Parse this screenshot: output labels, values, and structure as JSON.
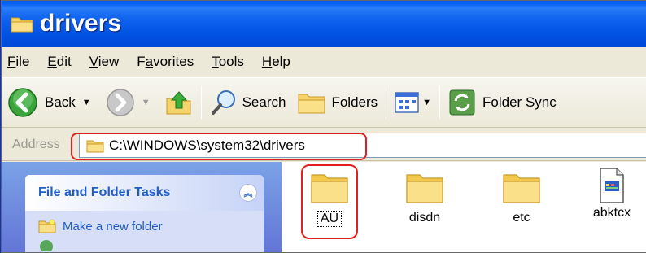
{
  "window": {
    "title": "drivers"
  },
  "menu": {
    "items": [
      {
        "accel": "F",
        "rest": "ile"
      },
      {
        "accel": "E",
        "rest": "dit"
      },
      {
        "accel": "V",
        "rest": "iew"
      },
      {
        "pre": "F",
        "accel": "a",
        "rest": "vorites"
      },
      {
        "accel": "T",
        "rest": "ools"
      },
      {
        "accel": "H",
        "rest": "elp"
      }
    ]
  },
  "toolbar": {
    "back_label": "Back",
    "search_label": "Search",
    "folders_label": "Folders",
    "folder_sync_label": "Folder Sync"
  },
  "address": {
    "label": "Address",
    "path": "C:\\WINDOWS\\system32\\drivers"
  },
  "tasks": {
    "title": "File and Folder Tasks",
    "items": [
      "Make a new folder"
    ]
  },
  "files": [
    {
      "name": "AU",
      "type": "folder",
      "selected": true
    },
    {
      "name": "disdn",
      "type": "folder",
      "selected": false
    },
    {
      "name": "etc",
      "type": "folder",
      "selected": false
    },
    {
      "name": "abktcx",
      "type": "file",
      "selected": false
    }
  ],
  "colors": {
    "title_bar": "#0254e4",
    "highlight": "#e02020",
    "task_link": "#215dc6"
  }
}
